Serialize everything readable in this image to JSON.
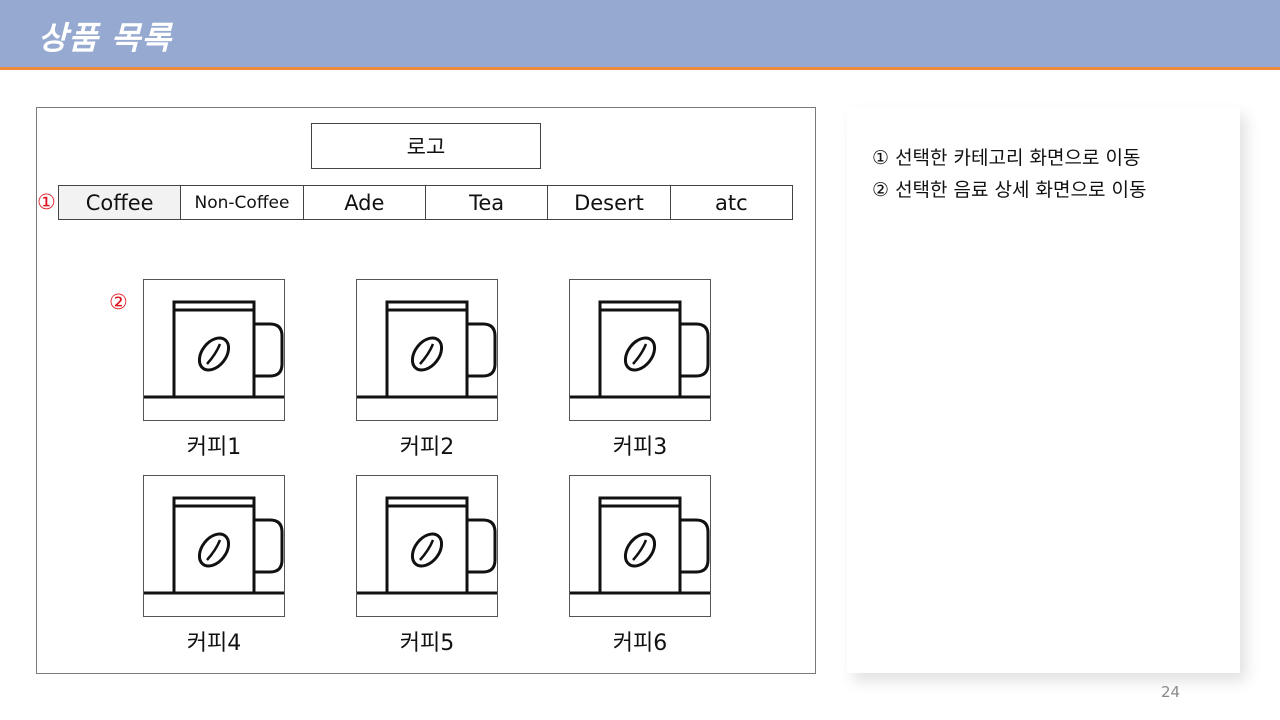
{
  "header": {
    "title": "상품 목록"
  },
  "mockup": {
    "logo_label": "로고",
    "markers": {
      "category": "①",
      "product": "②"
    },
    "tabs": [
      {
        "label": "Coffee",
        "selected": true
      },
      {
        "label": "Non-Coffee",
        "selected": false
      },
      {
        "label": "Ade",
        "selected": false
      },
      {
        "label": "Tea",
        "selected": false
      },
      {
        "label": "Desert",
        "selected": false
      },
      {
        "label": "atc",
        "selected": false
      }
    ],
    "products": [
      {
        "name": "커피1",
        "icon": "coffee-mug-icon"
      },
      {
        "name": "커피2",
        "icon": "coffee-mug-icon"
      },
      {
        "name": "커피3",
        "icon": "coffee-mug-icon"
      },
      {
        "name": "커피4",
        "icon": "coffee-mug-icon"
      },
      {
        "name": "커피5",
        "icon": "coffee-mug-icon"
      },
      {
        "name": "커피6",
        "icon": "coffee-mug-icon"
      }
    ]
  },
  "notes": [
    "①  선택한 카테고리 화면으로 이동",
    "②  선택한 음료 상세 화면으로 이동"
  ],
  "page_number": "24",
  "colors": {
    "header_bg": "#95a9d1",
    "header_underline": "#ee8a3a",
    "marker": "#e0141e",
    "selected_tab_bg": "#f2f2f2"
  }
}
